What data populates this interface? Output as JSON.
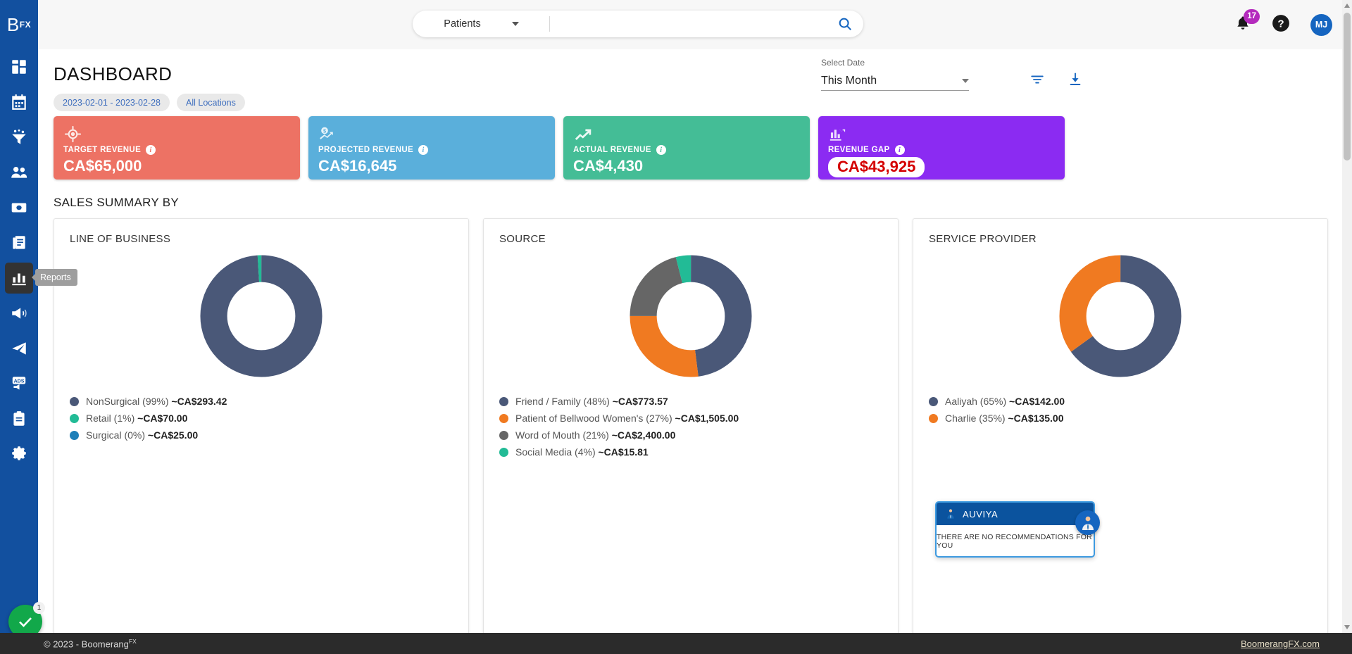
{
  "brand": {
    "logo_text": "B",
    "logo_sup": "FX",
    "accent": "#12509f"
  },
  "sidebar": {
    "items": [
      {
        "label": "Dashboard",
        "icon": "grid-dashboard-icon"
      },
      {
        "label": "Calendar",
        "icon": "calendar-icon"
      },
      {
        "label": "Leads",
        "icon": "funnel-icon"
      },
      {
        "label": "Patients",
        "icon": "people-icon"
      },
      {
        "label": "Payments",
        "icon": "money-icon"
      },
      {
        "label": "Documents",
        "icon": "documents-icon"
      },
      {
        "label": "Reports",
        "icon": "bar-chart-icon"
      },
      {
        "label": "Marketing",
        "icon": "megaphone-icon"
      },
      {
        "label": "Campaigns",
        "icon": "paper-plane-icon"
      },
      {
        "label": "Ads",
        "icon": "ads-icon"
      },
      {
        "label": "Inventory",
        "icon": "clipboard-icon"
      },
      {
        "label": "Settings",
        "icon": "gear-icon"
      }
    ],
    "active_tooltip": "Reports",
    "check_badge": "1"
  },
  "topbar": {
    "search_scope": "Patients",
    "search_value": "",
    "search_placeholder": "",
    "notification_count": "17",
    "avatar_initials": "MJ"
  },
  "header": {
    "title": "DASHBOARD",
    "chips": [
      "2023-02-01 - 2023-02-28",
      "All Locations"
    ],
    "date_label": "Select Date",
    "date_value": "This Month"
  },
  "kpis": [
    {
      "label": "TARGET REVENUE",
      "value": "CA$65,000",
      "color": "#ed7264",
      "icon": "target-icon",
      "highlight": false
    },
    {
      "label": "PROJECTED REVENUE",
      "value": "CA$16,645",
      "color": "#5aafdb",
      "icon": "money-trend-icon",
      "highlight": false
    },
    {
      "label": "ACTUAL REVENUE",
      "value": "CA$4,430",
      "color": "#44bd96",
      "icon": "trend-up-icon",
      "highlight": false
    },
    {
      "label": "REVENUE GAP",
      "value": "CA$43,925",
      "color": "#8b2bf2",
      "icon": "bar-decline-icon",
      "highlight": true
    }
  ],
  "sales_summary": {
    "title": "SALES SUMMARY BY"
  },
  "chart_data": [
    {
      "type": "pie",
      "title": "LINE OF BUSINESS",
      "legend_position": "bottom",
      "categories": [
        "NonSurgical",
        "Retail",
        "Surgical"
      ],
      "values": [
        99,
        1,
        0
      ],
      "colors": [
        "#4a5878",
        "#22bb96",
        "#1d7fb8"
      ],
      "labels": [
        {
          "name": "NonSurgical",
          "pct": "(99%)",
          "amount": "~CA$293.42"
        },
        {
          "name": "Retail",
          "pct": "(1%)",
          "amount": "~CA$70.00"
        },
        {
          "name": "Surgical",
          "pct": "(0%)",
          "amount": "~CA$25.00"
        }
      ]
    },
    {
      "type": "pie",
      "title": "SOURCE",
      "legend_position": "bottom",
      "categories": [
        "Friend / Family",
        "Patient of Bellwood Women's",
        "Word of Mouth",
        "Social Media"
      ],
      "values": [
        48,
        27,
        21,
        4
      ],
      "colors": [
        "#4a5878",
        "#f07a21",
        "#666666",
        "#22bb96"
      ],
      "labels": [
        {
          "name": "Friend / Family",
          "pct": "(48%)",
          "amount": "~CA$773.57"
        },
        {
          "name": "Patient of Bellwood Women's",
          "pct": "(27%)",
          "amount": "~CA$1,505.00"
        },
        {
          "name": "Word of Mouth",
          "pct": "(21%)",
          "amount": "~CA$2,400.00"
        },
        {
          "name": "Social Media",
          "pct": "(4%)",
          "amount": "~CA$15.81"
        }
      ]
    },
    {
      "type": "pie",
      "title": "SERVICE PROVIDER",
      "legend_position": "bottom",
      "categories": [
        "Aaliyah",
        "Charlie"
      ],
      "values": [
        65,
        35
      ],
      "colors": [
        "#4a5878",
        "#f07a21"
      ],
      "labels": [
        {
          "name": "Aaliyah",
          "pct": "(65%)",
          "amount": "~CA$142.00"
        },
        {
          "name": "Charlie",
          "pct": "(35%)",
          "amount": "~CA$135.00"
        }
      ]
    }
  ],
  "auviya": {
    "title": "AUVIYA",
    "message": "THERE ARE NO RECOMMENDATIONS FOR YOU"
  },
  "footer": {
    "copyright": "© 2023 - Boomerang",
    "copyright_sup": "FX",
    "link": "BoomerangFX.com"
  }
}
